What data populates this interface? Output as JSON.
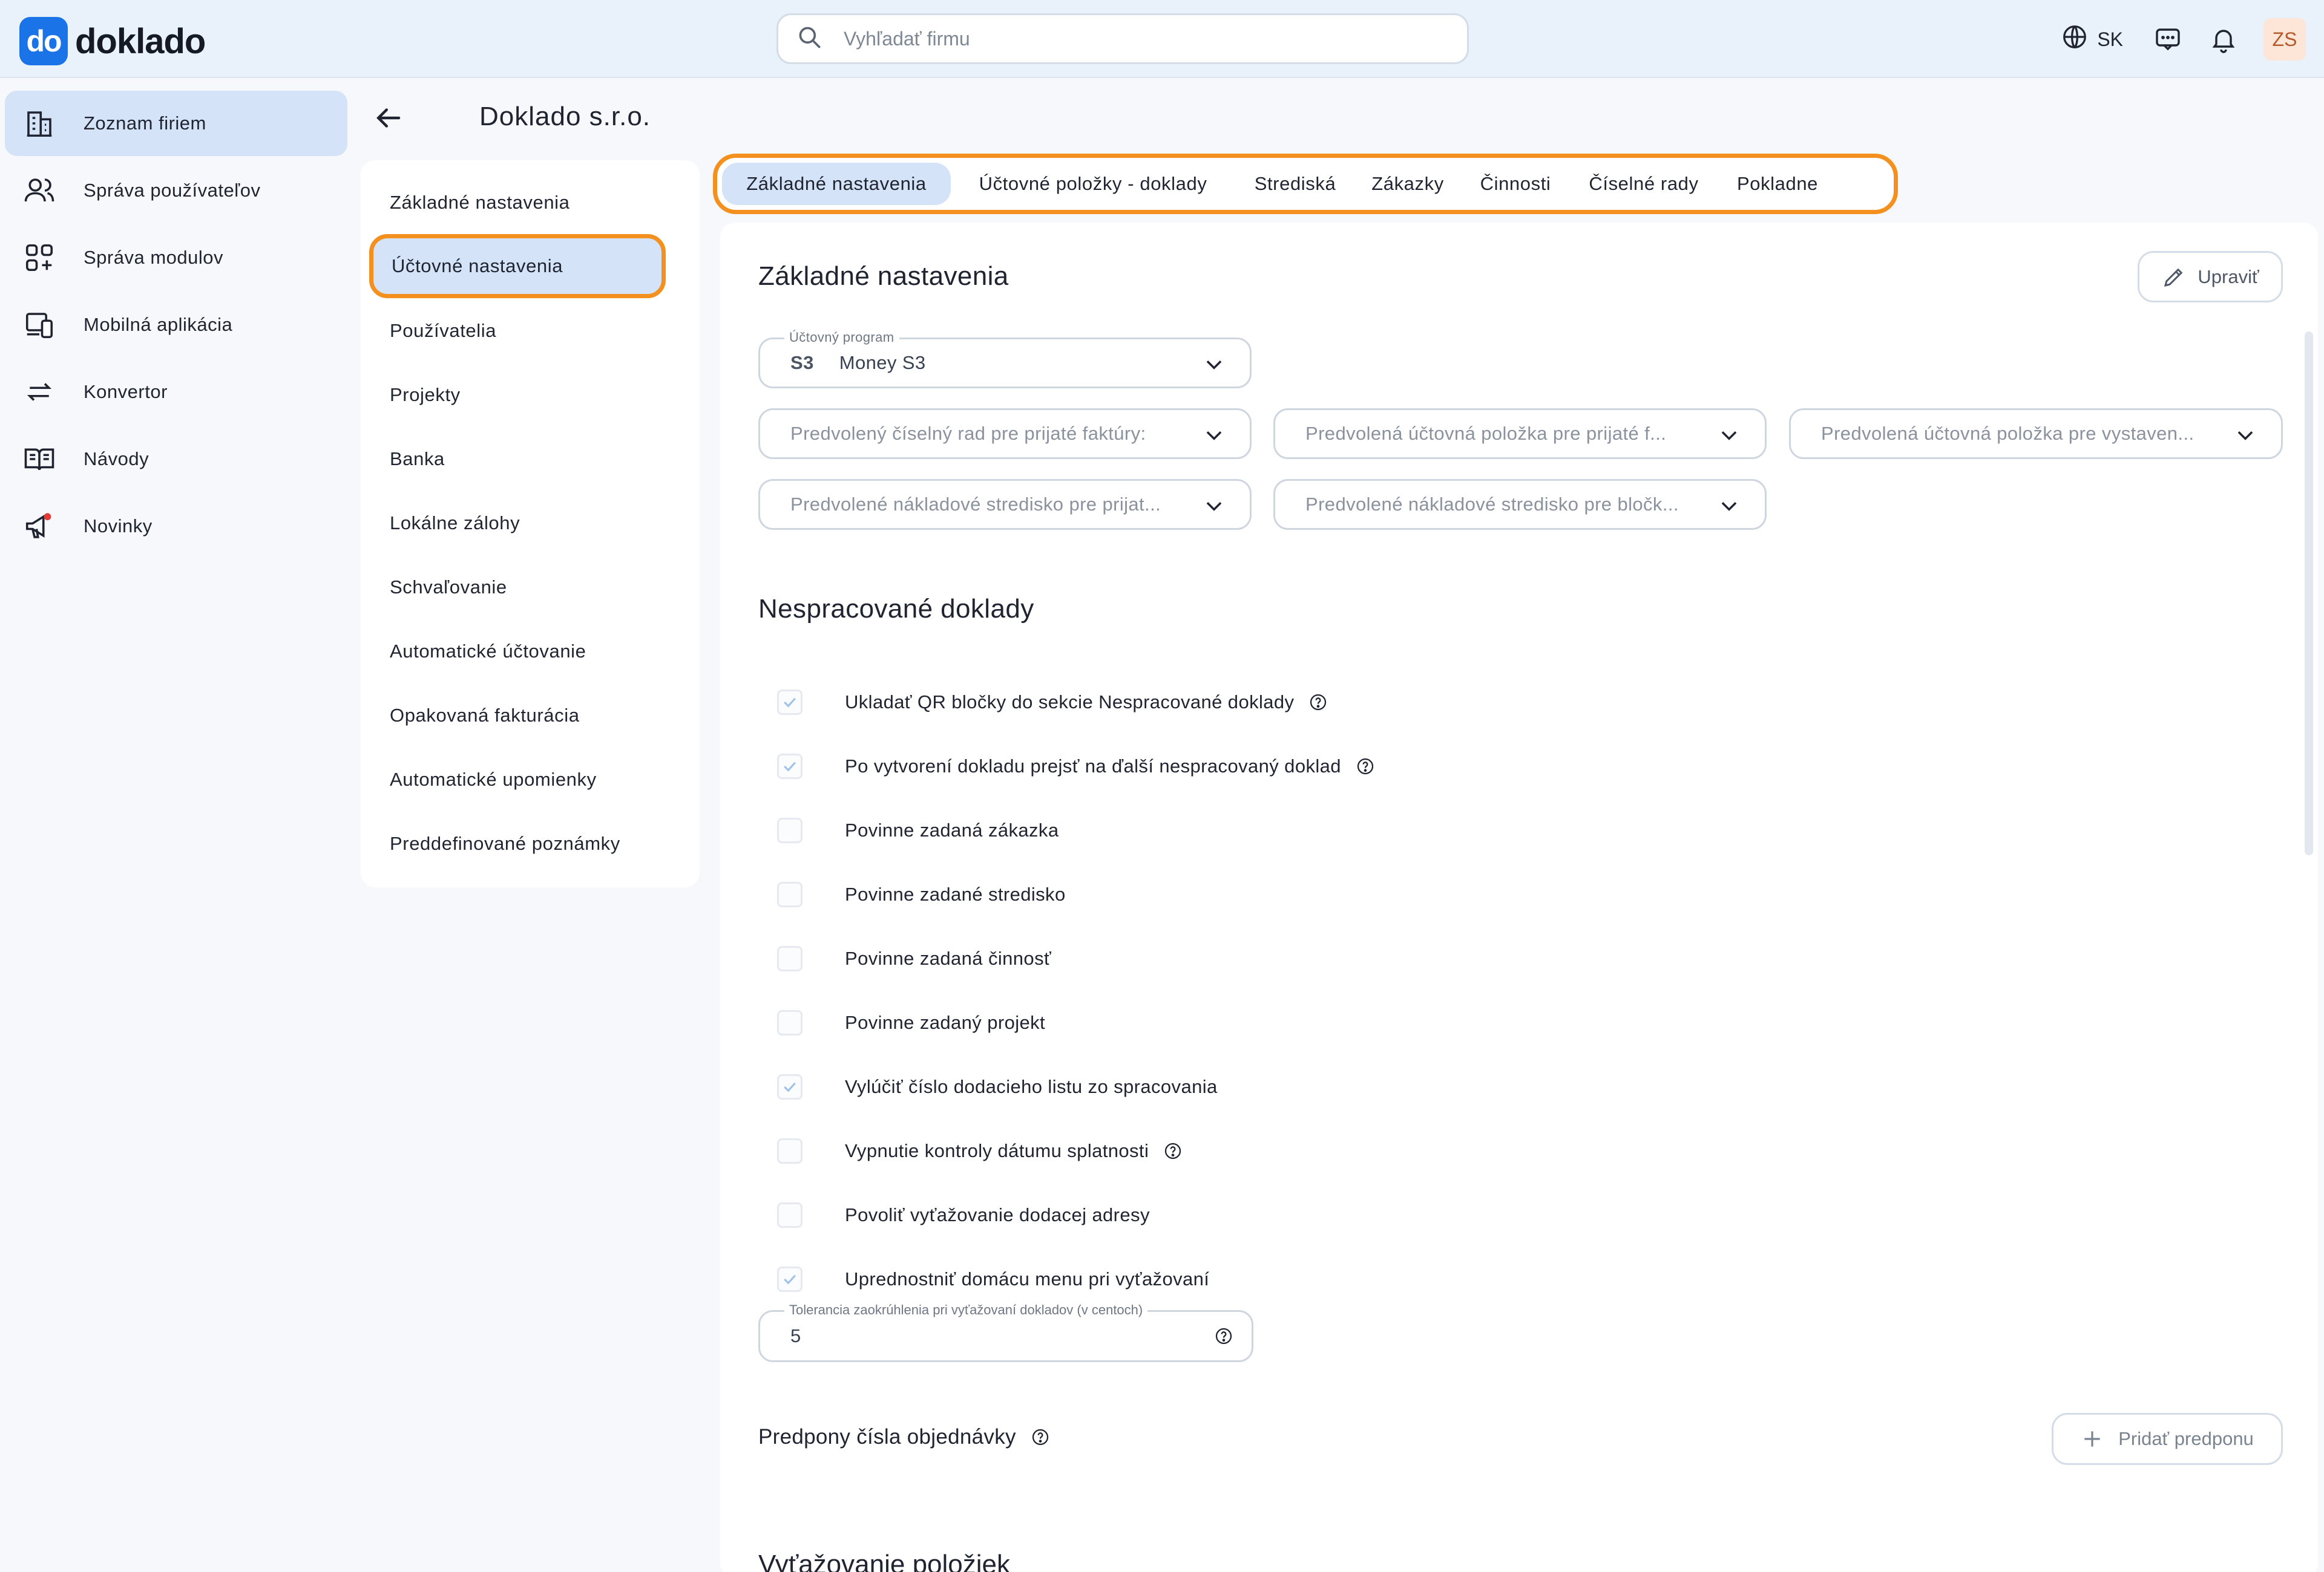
{
  "app": {
    "logo_badge": "do",
    "logo_text": "doklado"
  },
  "search": {
    "placeholder": "Vyhľadať firmu"
  },
  "header": {
    "language": "SK",
    "avatar_initials": "ZS"
  },
  "sidebar": {
    "items": [
      {
        "label": "Zoznam firiem",
        "icon": "buildings-icon",
        "active": true
      },
      {
        "label": "Správa používateľov",
        "icon": "users-icon",
        "active": false
      },
      {
        "label": "Správa modulov",
        "icon": "modules-icon",
        "active": false
      },
      {
        "label": "Mobilná aplikácia",
        "icon": "mobile-app-icon",
        "active": false
      },
      {
        "label": "Konvertor",
        "icon": "convert-arrows-icon",
        "active": false
      },
      {
        "label": "Návody",
        "icon": "book-icon",
        "active": false
      },
      {
        "label": "Novinky",
        "icon": "megaphone-icon",
        "active": false
      }
    ]
  },
  "company": {
    "title": "Doklado s.r.o."
  },
  "settings_nav": {
    "items": [
      "Základné nastavenia",
      "Účtovné nastavenia",
      "Používatelia",
      "Projekty",
      "Banka",
      "Lokálne zálohy",
      "Schvaľovanie",
      "Automatické účtovanie",
      "Opakovaná fakturácia",
      "Automatické upomienky",
      "Preddefinované poznámky"
    ],
    "active_index": 1
  },
  "tabs": {
    "items": [
      "Základné nastavenia",
      "Účtovné položky - doklady",
      "Strediská",
      "Zákazky",
      "Činnosti",
      "Číselné rady",
      "Pokladne"
    ],
    "active_index": 0
  },
  "basic": {
    "title": "Základné nastavenia",
    "edit_label": "Upraviť",
    "program_label": "Účtovný program",
    "program_code": "S3",
    "program_value": "Money S3",
    "selects": [
      "Predvolený číselný rad pre prijaté faktúry:",
      "Predvolená účtovná položka pre prijaté f...",
      "Predvolená účtovná položka pre vystaven...",
      "Predvolené nákladové stredisko pre prijat...",
      "Predvolené nákladové stredisko pre bločk..."
    ]
  },
  "unprocessed": {
    "title": "Nespracované doklady",
    "options": [
      {
        "label": "Ukladať QR bločky do sekcie Nespracované doklady",
        "checked": true,
        "help": true
      },
      {
        "label": "Po vytvorení dokladu prejsť na ďalší nespracovaný doklad",
        "checked": true,
        "help": true
      },
      {
        "label": "Povinne zadaná zákazka",
        "checked": false,
        "help": false
      },
      {
        "label": "Povinne zadané stredisko",
        "checked": false,
        "help": false
      },
      {
        "label": "Povinne zadaná činnosť",
        "checked": false,
        "help": false
      },
      {
        "label": "Povinne zadaný projekt",
        "checked": false,
        "help": false
      },
      {
        "label": "Vylúčiť číslo dodacieho listu zo spracovania",
        "checked": true,
        "help": false
      },
      {
        "label": "Vypnutie kontroly dátumu splatnosti",
        "checked": false,
        "help": true
      },
      {
        "label": "Povoliť vyťažovanie dodacej adresy",
        "checked": false,
        "help": false
      },
      {
        "label": "Uprednostniť domácu menu pri vyťažovaní",
        "checked": true,
        "help": false
      }
    ],
    "tolerance_label": "Tolerancia zaokrúhlenia pri vyťažovaní dokladov (v centoch)",
    "tolerance_value": "5"
  },
  "prefixes": {
    "title": "Predpony čísla objednávky",
    "add_label": "Pridať predponu"
  },
  "next_section": {
    "title": "Vyťažovanie položiek"
  },
  "colors": {
    "accent": "#1b73e8",
    "highlight": "#f3901e",
    "active_bg": "#d4e3f8"
  }
}
